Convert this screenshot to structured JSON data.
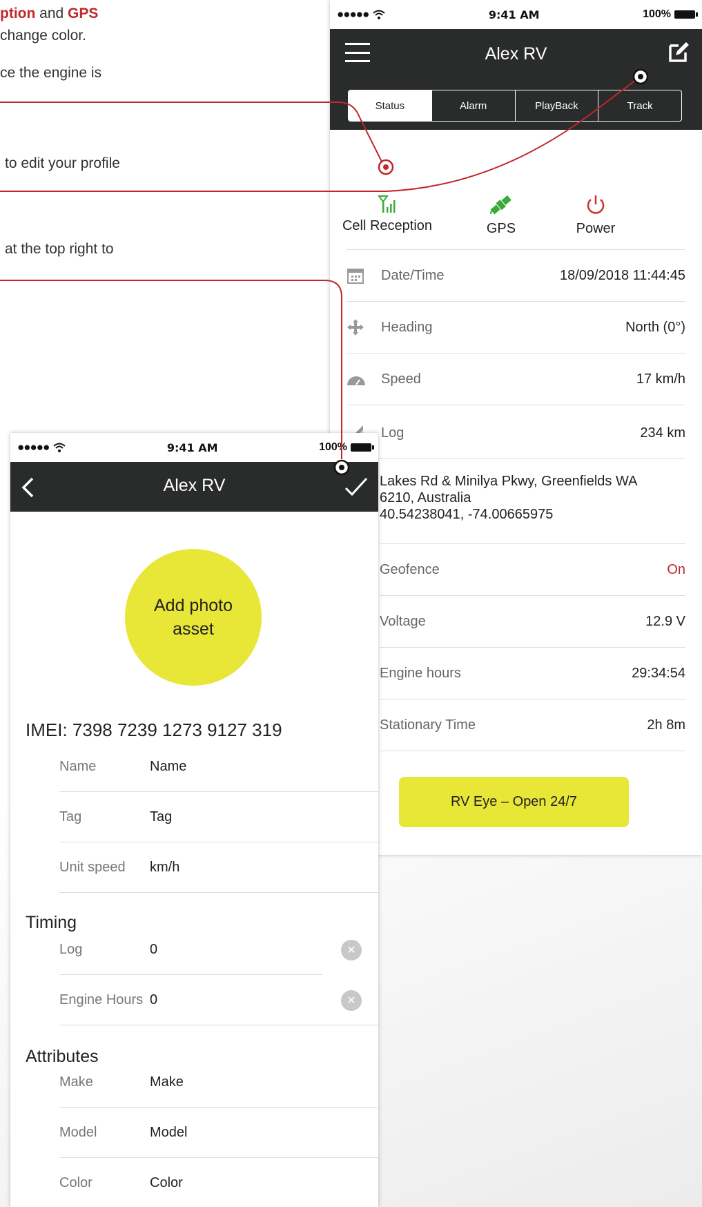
{
  "annotations": {
    "line1_bold1": "ption",
    "line1_and": " and ",
    "line1_bold2": "GPS",
    "line2": "change color.",
    "line3": "ce the engine is",
    "line4": "to edit your profile",
    "line5": "at the top right to"
  },
  "colors": {
    "accent_red": "#c1272d",
    "header_dark": "#2a2b2b",
    "yellow": "#e8e636",
    "green": "#3aaa3a"
  },
  "status_phone": {
    "statusbar": {
      "signal": "●●●●● ",
      "wifi": "wifi-icon",
      "time": "9:41 AM",
      "battery": "100%"
    },
    "title": "Alex RV",
    "tabs": [
      "Status",
      "Alarm",
      "PlayBack",
      "Track"
    ],
    "indicators": [
      {
        "label": "Cell Reception",
        "icon": "cell-signal-icon"
      },
      {
        "label": "GPS",
        "icon": "satellite-icon"
      },
      {
        "label": "Power",
        "icon": "power-icon"
      }
    ],
    "details": {
      "datetime": {
        "label": "Date/Time",
        "value": "18/09/2018 11:44:45"
      },
      "heading": {
        "label": "Heading",
        "value": "North (0°)"
      },
      "speed": {
        "label": "Speed",
        "value": "17 km/h"
      },
      "log": {
        "label": "Log",
        "value": "234 km"
      },
      "address": {
        "line1": "Lakes Rd & Minilya Pkwy, Greenfields WA",
        "line2": "6210, Australia",
        "coords": "40.54238041, -74.00665975"
      },
      "geofence": {
        "label": "Geofence",
        "value": "On"
      },
      "voltage": {
        "label": "Voltage",
        "value": "12.9 V"
      },
      "engine_hours": {
        "label": "Engine hours",
        "value": "29:34:54"
      },
      "stationary": {
        "label": "Stationary Time",
        "value": "2h 8m"
      }
    },
    "rv_eye_button": "RV Eye – Open 24/7"
  },
  "edit_phone": {
    "statusbar": {
      "signal": "●●●●● ",
      "time": "9:41 AM",
      "battery": "100%"
    },
    "title": "Alex RV",
    "photo_line1": "Add photo",
    "photo_line2": "asset",
    "imei": "IMEI: 7398 7239 1273 9127 319",
    "fields": {
      "name": {
        "label": "Name",
        "value": "Name"
      },
      "tag": {
        "label": "Tag",
        "value": "Tag"
      },
      "unit_speed": {
        "label": "Unit speed",
        "value": "km/h"
      }
    },
    "timing_title": "Timing",
    "timing": {
      "log": {
        "label": "Log",
        "value": "0"
      },
      "engine_hours": {
        "label": "Engine Hours",
        "value": "0"
      }
    },
    "attributes_title": "Attributes",
    "attributes": {
      "make": {
        "label": "Make",
        "value": "Make"
      },
      "model": {
        "label": "Model",
        "value": "Model"
      },
      "color": {
        "label": "Color",
        "value": "Color"
      }
    }
  }
}
